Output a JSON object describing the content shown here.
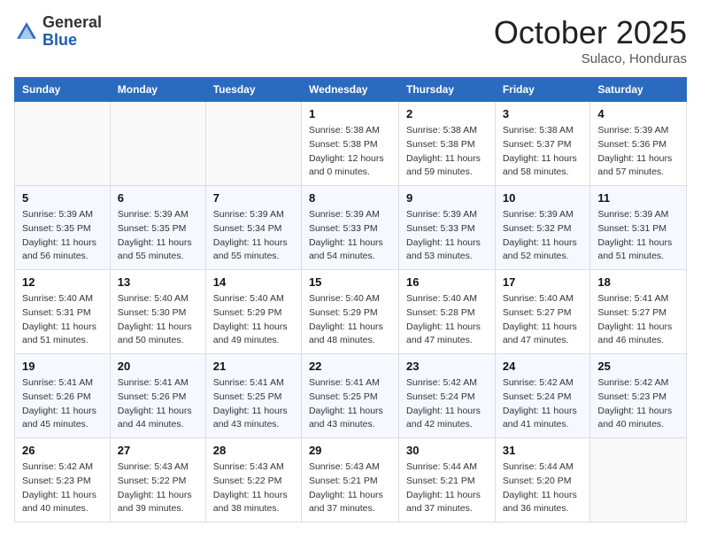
{
  "header": {
    "logo_line1": "General",
    "logo_line2": "Blue",
    "month": "October 2025",
    "location": "Sulaco, Honduras"
  },
  "weekdays": [
    "Sunday",
    "Monday",
    "Tuesday",
    "Wednesday",
    "Thursday",
    "Friday",
    "Saturday"
  ],
  "weeks": [
    [
      {
        "day": "",
        "sunrise": "",
        "sunset": "",
        "daylight": ""
      },
      {
        "day": "",
        "sunrise": "",
        "sunset": "",
        "daylight": ""
      },
      {
        "day": "",
        "sunrise": "",
        "sunset": "",
        "daylight": ""
      },
      {
        "day": "1",
        "sunrise": "Sunrise: 5:38 AM",
        "sunset": "Sunset: 5:38 PM",
        "daylight": "Daylight: 12 hours and 0 minutes."
      },
      {
        "day": "2",
        "sunrise": "Sunrise: 5:38 AM",
        "sunset": "Sunset: 5:38 PM",
        "daylight": "Daylight: 11 hours and 59 minutes."
      },
      {
        "day": "3",
        "sunrise": "Sunrise: 5:38 AM",
        "sunset": "Sunset: 5:37 PM",
        "daylight": "Daylight: 11 hours and 58 minutes."
      },
      {
        "day": "4",
        "sunrise": "Sunrise: 5:39 AM",
        "sunset": "Sunset: 5:36 PM",
        "daylight": "Daylight: 11 hours and 57 minutes."
      }
    ],
    [
      {
        "day": "5",
        "sunrise": "Sunrise: 5:39 AM",
        "sunset": "Sunset: 5:35 PM",
        "daylight": "Daylight: 11 hours and 56 minutes."
      },
      {
        "day": "6",
        "sunrise": "Sunrise: 5:39 AM",
        "sunset": "Sunset: 5:35 PM",
        "daylight": "Daylight: 11 hours and 55 minutes."
      },
      {
        "day": "7",
        "sunrise": "Sunrise: 5:39 AM",
        "sunset": "Sunset: 5:34 PM",
        "daylight": "Daylight: 11 hours and 55 minutes."
      },
      {
        "day": "8",
        "sunrise": "Sunrise: 5:39 AM",
        "sunset": "Sunset: 5:33 PM",
        "daylight": "Daylight: 11 hours and 54 minutes."
      },
      {
        "day": "9",
        "sunrise": "Sunrise: 5:39 AM",
        "sunset": "Sunset: 5:33 PM",
        "daylight": "Daylight: 11 hours and 53 minutes."
      },
      {
        "day": "10",
        "sunrise": "Sunrise: 5:39 AM",
        "sunset": "Sunset: 5:32 PM",
        "daylight": "Daylight: 11 hours and 52 minutes."
      },
      {
        "day": "11",
        "sunrise": "Sunrise: 5:39 AM",
        "sunset": "Sunset: 5:31 PM",
        "daylight": "Daylight: 11 hours and 51 minutes."
      }
    ],
    [
      {
        "day": "12",
        "sunrise": "Sunrise: 5:40 AM",
        "sunset": "Sunset: 5:31 PM",
        "daylight": "Daylight: 11 hours and 51 minutes."
      },
      {
        "day": "13",
        "sunrise": "Sunrise: 5:40 AM",
        "sunset": "Sunset: 5:30 PM",
        "daylight": "Daylight: 11 hours and 50 minutes."
      },
      {
        "day": "14",
        "sunrise": "Sunrise: 5:40 AM",
        "sunset": "Sunset: 5:29 PM",
        "daylight": "Daylight: 11 hours and 49 minutes."
      },
      {
        "day": "15",
        "sunrise": "Sunrise: 5:40 AM",
        "sunset": "Sunset: 5:29 PM",
        "daylight": "Daylight: 11 hours and 48 minutes."
      },
      {
        "day": "16",
        "sunrise": "Sunrise: 5:40 AM",
        "sunset": "Sunset: 5:28 PM",
        "daylight": "Daylight: 11 hours and 47 minutes."
      },
      {
        "day": "17",
        "sunrise": "Sunrise: 5:40 AM",
        "sunset": "Sunset: 5:27 PM",
        "daylight": "Daylight: 11 hours and 47 minutes."
      },
      {
        "day": "18",
        "sunrise": "Sunrise: 5:41 AM",
        "sunset": "Sunset: 5:27 PM",
        "daylight": "Daylight: 11 hours and 46 minutes."
      }
    ],
    [
      {
        "day": "19",
        "sunrise": "Sunrise: 5:41 AM",
        "sunset": "Sunset: 5:26 PM",
        "daylight": "Daylight: 11 hours and 45 minutes."
      },
      {
        "day": "20",
        "sunrise": "Sunrise: 5:41 AM",
        "sunset": "Sunset: 5:26 PM",
        "daylight": "Daylight: 11 hours and 44 minutes."
      },
      {
        "day": "21",
        "sunrise": "Sunrise: 5:41 AM",
        "sunset": "Sunset: 5:25 PM",
        "daylight": "Daylight: 11 hours and 43 minutes."
      },
      {
        "day": "22",
        "sunrise": "Sunrise: 5:41 AM",
        "sunset": "Sunset: 5:25 PM",
        "daylight": "Daylight: 11 hours and 43 minutes."
      },
      {
        "day": "23",
        "sunrise": "Sunrise: 5:42 AM",
        "sunset": "Sunset: 5:24 PM",
        "daylight": "Daylight: 11 hours and 42 minutes."
      },
      {
        "day": "24",
        "sunrise": "Sunrise: 5:42 AM",
        "sunset": "Sunset: 5:24 PM",
        "daylight": "Daylight: 11 hours and 41 minutes."
      },
      {
        "day": "25",
        "sunrise": "Sunrise: 5:42 AM",
        "sunset": "Sunset: 5:23 PM",
        "daylight": "Daylight: 11 hours and 40 minutes."
      }
    ],
    [
      {
        "day": "26",
        "sunrise": "Sunrise: 5:42 AM",
        "sunset": "Sunset: 5:23 PM",
        "daylight": "Daylight: 11 hours and 40 minutes."
      },
      {
        "day": "27",
        "sunrise": "Sunrise: 5:43 AM",
        "sunset": "Sunset: 5:22 PM",
        "daylight": "Daylight: 11 hours and 39 minutes."
      },
      {
        "day": "28",
        "sunrise": "Sunrise: 5:43 AM",
        "sunset": "Sunset: 5:22 PM",
        "daylight": "Daylight: 11 hours and 38 minutes."
      },
      {
        "day": "29",
        "sunrise": "Sunrise: 5:43 AM",
        "sunset": "Sunset: 5:21 PM",
        "daylight": "Daylight: 11 hours and 37 minutes."
      },
      {
        "day": "30",
        "sunrise": "Sunrise: 5:44 AM",
        "sunset": "Sunset: 5:21 PM",
        "daylight": "Daylight: 11 hours and 37 minutes."
      },
      {
        "day": "31",
        "sunrise": "Sunrise: 5:44 AM",
        "sunset": "Sunset: 5:20 PM",
        "daylight": "Daylight: 11 hours and 36 minutes."
      },
      {
        "day": "",
        "sunrise": "",
        "sunset": "",
        "daylight": ""
      }
    ]
  ]
}
